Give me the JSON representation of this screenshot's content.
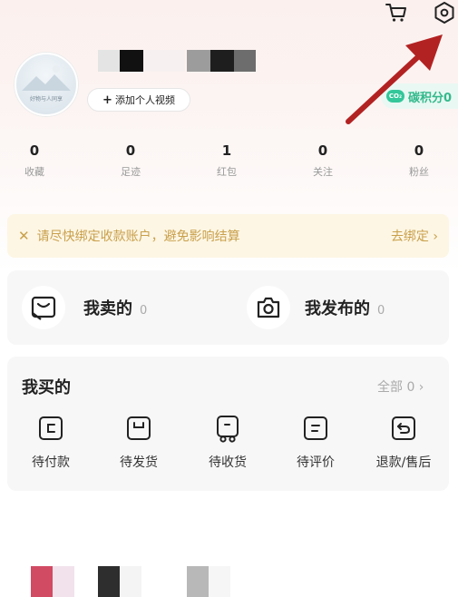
{
  "header": {
    "cart_icon": "cart-icon",
    "settings_icon": "settings-icon"
  },
  "profile": {
    "avatar_caption": "好物与人同享",
    "add_video_label": "添加个人视频",
    "carbon_label": "碳积分0",
    "carbon_badge": "CO₂"
  },
  "stats": [
    {
      "value": "0",
      "label": "收藏"
    },
    {
      "value": "0",
      "label": "足迹"
    },
    {
      "value": "1",
      "label": "红包"
    },
    {
      "value": "0",
      "label": "关注"
    },
    {
      "value": "0",
      "label": "粉丝"
    }
  ],
  "banner": {
    "close_icon": "close-icon",
    "text": "请尽快绑定收款账户，避免影响结算",
    "action": "去绑定 ›"
  },
  "sell": {
    "label": "我卖的",
    "count": "0"
  },
  "publish": {
    "label": "我发布的",
    "count": "0"
  },
  "buy": {
    "title": "我买的",
    "all_label": "全部 0 ›",
    "items": [
      {
        "label": "待付款",
        "icon": "wallet-icon"
      },
      {
        "label": "待发货",
        "icon": "box-icon"
      },
      {
        "label": "待收货",
        "icon": "truck-icon"
      },
      {
        "label": "待评价",
        "icon": "review-icon"
      },
      {
        "label": "退款/售后",
        "icon": "refund-icon"
      }
    ]
  },
  "colors": {
    "accent_green": "#33b98c",
    "banner_text": "#c9a04c",
    "arrow": "#b32222"
  }
}
